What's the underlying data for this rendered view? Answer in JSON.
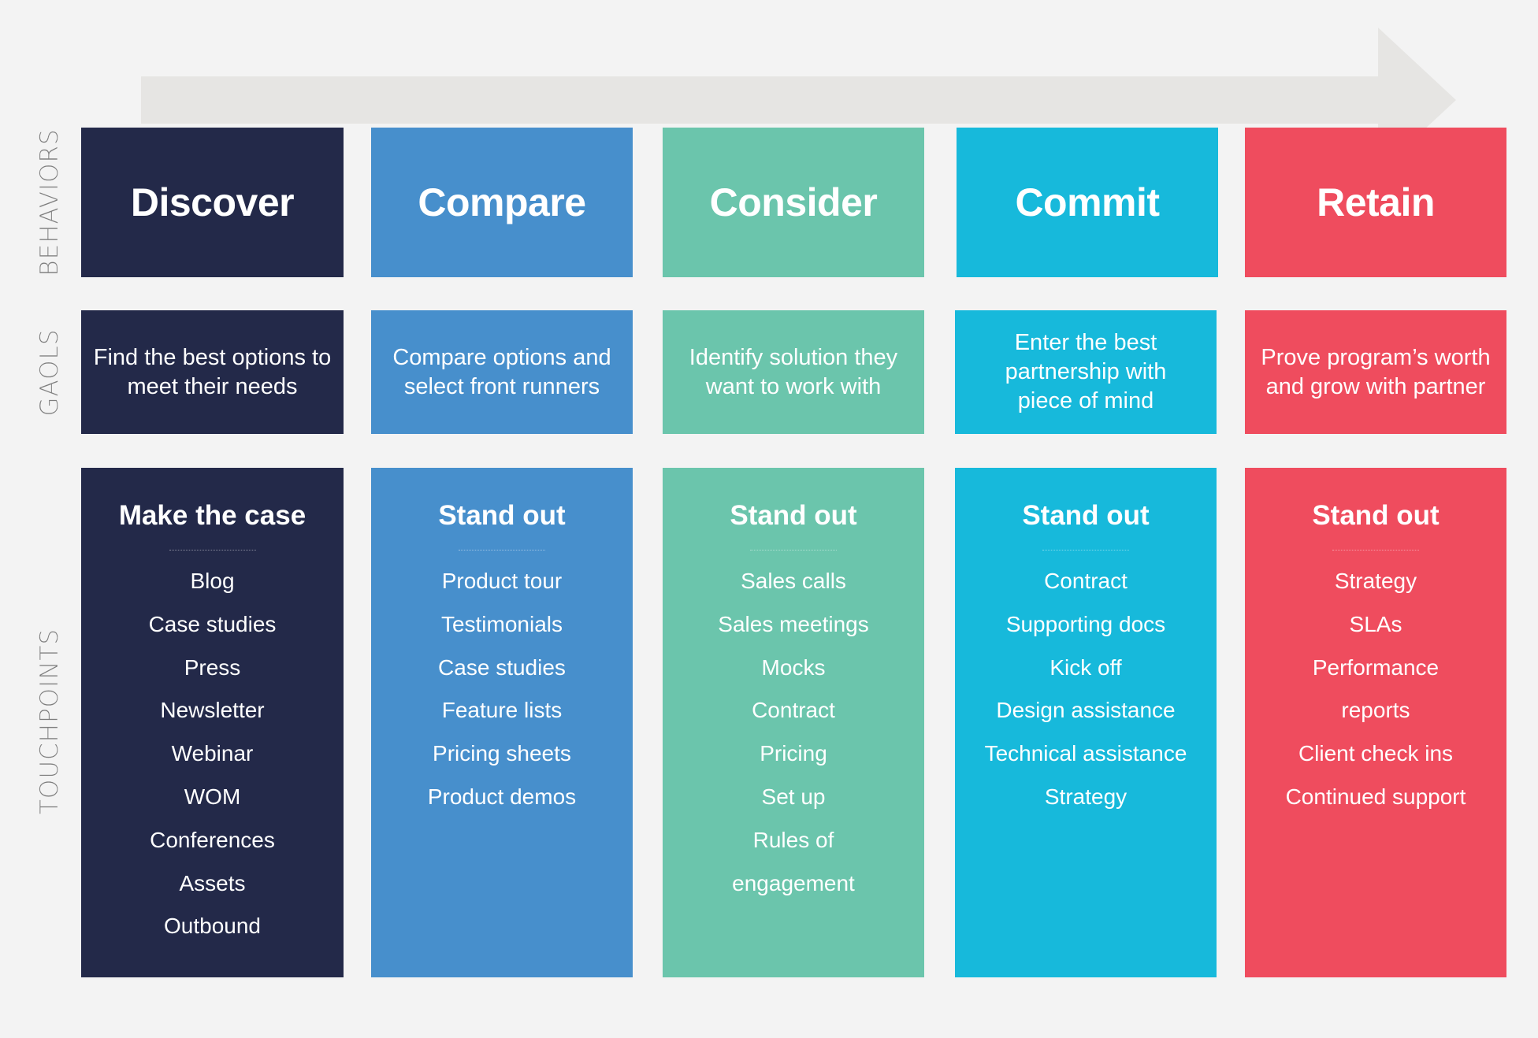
{
  "row_labels": {
    "behaviors": "BEHAVIORS",
    "goals": "GAOLS",
    "touchpoints": "TOUCHPOINTS"
  },
  "arrow": {
    "color": "#e6e5e3",
    "direction": "right"
  },
  "stages": [
    {
      "key": "discover",
      "color": "#232949",
      "behavior": "Discover",
      "goal": "Find the best options to meet their needs",
      "touchpoint_title": "Make the case",
      "touchpoints": [
        "Blog",
        "Case studies",
        "Press",
        "Newsletter",
        "Webinar",
        "WOM",
        "Conferences",
        "Assets",
        "Outbound"
      ]
    },
    {
      "key": "compare",
      "color": "#478fcc",
      "behavior": "Compare",
      "goal": "Compare options and select front runners",
      "touchpoint_title": "Stand out",
      "touchpoints": [
        "Product tour",
        "Testimonials",
        "Case studies",
        "Feature lists",
        "Pricing sheets",
        "Product demos"
      ]
    },
    {
      "key": "consider",
      "color": "#6bc5ac",
      "behavior": "Consider",
      "goal": "Identify solution they want to work with",
      "touchpoint_title": "Stand out",
      "touchpoints": [
        "Sales calls",
        "Sales meetings",
        "Mocks",
        "Contract",
        "Pricing",
        "Set up",
        "Rules of",
        "engagement"
      ]
    },
    {
      "key": "commit",
      "color": "#17b9db",
      "behavior": "Commit",
      "goal": "Enter the best partnership with piece of mind",
      "touchpoint_title": "Stand out",
      "touchpoints": [
        "Contract",
        "Supporting docs",
        "Kick off",
        "Design assistance",
        "Technical assistance",
        "Strategy"
      ]
    },
    {
      "key": "retain",
      "color": "#ef4c5e",
      "behavior": "Retain",
      "goal": "Prove program’s worth and grow with partner",
      "touchpoint_title": "Stand out",
      "touchpoints": [
        "Strategy",
        "SLAs",
        "Performance",
        "reports",
        "Client check ins",
        "Continued support"
      ]
    }
  ]
}
